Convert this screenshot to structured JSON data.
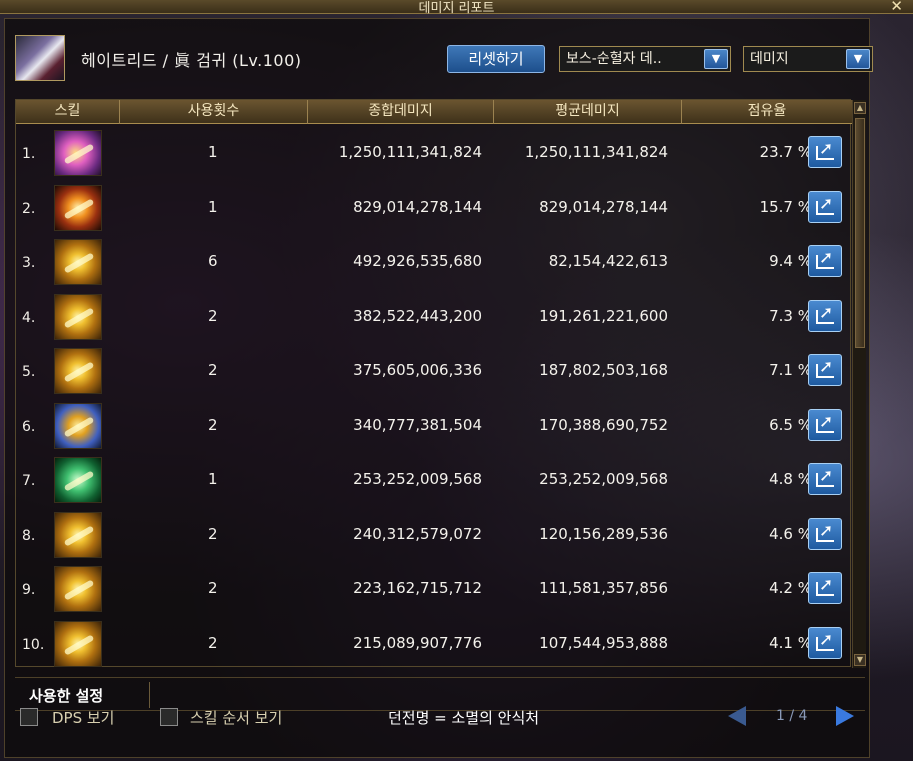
{
  "window": {
    "title": "데미지 리포트",
    "close_label": "✕"
  },
  "header": {
    "character": "헤이트리드 / 眞 검귀 (Lv.100)",
    "reset_label": "리셋하기",
    "filter_select": "보스-순혈자 데..",
    "mode_select": "데미지"
  },
  "table": {
    "headers": [
      "스킬",
      "사용횟수",
      "종합데미지",
      "평균데미지",
      "점유율"
    ],
    "rows": [
      {
        "rank": "1.",
        "uses": "1",
        "total": "1,250,111,341,824",
        "avg": "1,250,111,341,824",
        "share": "23.7 %"
      },
      {
        "rank": "2.",
        "uses": "1",
        "total": "829,014,278,144",
        "avg": "829,014,278,144",
        "share": "15.7 %"
      },
      {
        "rank": "3.",
        "uses": "6",
        "total": "492,926,535,680",
        "avg": "82,154,422,613",
        "share": "9.4 %"
      },
      {
        "rank": "4.",
        "uses": "2",
        "total": "382,522,443,200",
        "avg": "191,261,221,600",
        "share": "7.3 %"
      },
      {
        "rank": "5.",
        "uses": "2",
        "total": "375,605,006,336",
        "avg": "187,802,503,168",
        "share": "7.1 %"
      },
      {
        "rank": "6.",
        "uses": "2",
        "total": "340,777,381,504",
        "avg": "170,388,690,752",
        "share": "6.5 %"
      },
      {
        "rank": "7.",
        "uses": "1",
        "total": "253,252,009,568",
        "avg": "253,252,009,568",
        "share": "4.8 %"
      },
      {
        "rank": "8.",
        "uses": "2",
        "total": "240,312,579,072",
        "avg": "120,156,289,536",
        "share": "4.6 %"
      },
      {
        "rank": "9.",
        "uses": "2",
        "total": "223,162,715,712",
        "avg": "111,581,357,856",
        "share": "4.2 %"
      },
      {
        "rank": "10.",
        "uses": "2",
        "total": "215,089,907,776",
        "avg": "107,544,953,888",
        "share": "4.1 %"
      }
    ]
  },
  "tabs": {
    "used_settings": "사용한 설정"
  },
  "footer": {
    "dps_label": "DPS 보기",
    "skill_order_label": "스킬 순서 보기",
    "dungeon": "던전명 = 소멸의 안식처",
    "page": "1 / 4"
  }
}
